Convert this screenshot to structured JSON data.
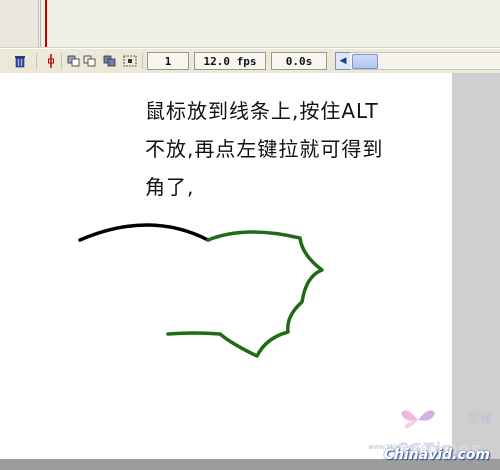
{
  "status_bar": {
    "frame_number": "1",
    "frame_rate": "12.0 fps",
    "elapsed_time": "0.0s"
  },
  "stage": {
    "instruction_text": "鼠标放到线条上,按住ALT\n不放,再点左键拉就可得到\n角了,",
    "colors": {
      "black_line": "#000000",
      "green_line": "#1f6b16",
      "background": "#ffffff",
      "pasteboard": "#cfcfcf"
    }
  },
  "watermark": {
    "site_name": "思缘",
    "brand": "CGTimes",
    "url": "Chinavid.com",
    "small_text": "www.Missyuan.com"
  },
  "icons": {
    "trash": "trash-icon",
    "center_frame": "center-frame-icon",
    "onion_skin": "onion-skin-icon",
    "onion_outline": "onion-skin-outlines-icon",
    "edit_multiple": "edit-multiple-frames-icon",
    "modify_markers": "modify-onion-markers-icon",
    "scroll_left": "scroll-left-icon"
  }
}
